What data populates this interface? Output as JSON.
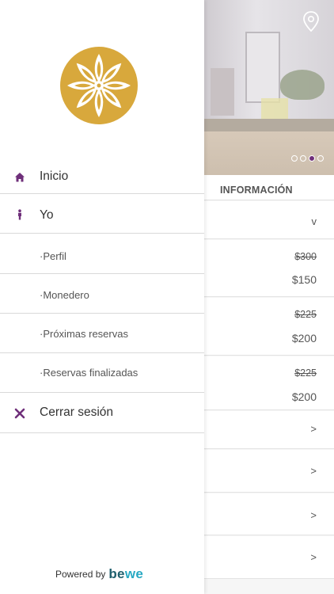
{
  "drawer": {
    "menu": [
      {
        "label": "Inicio",
        "icon": "home-icon"
      },
      {
        "label": "Yo",
        "icon": "person-icon"
      },
      {
        "label": "·Perfil"
      },
      {
        "label": "·Monedero"
      },
      {
        "label": "·Próximas reservas"
      },
      {
        "label": "·Reservas finalizadas"
      },
      {
        "label": "Cerrar sesión",
        "icon": "close-icon"
      }
    ],
    "footer": {
      "powered_by": "Powered by",
      "brand_be": "be",
      "brand_we": "we"
    }
  },
  "background": {
    "section_title": "INFORMACIÓN",
    "carousel": {
      "pages": 4,
      "active_index": 2
    },
    "rows": [
      {
        "chevron": "v"
      },
      {
        "old_price": "$300",
        "price": "$150"
      },
      {
        "old_price": "$225",
        "price": "$200"
      },
      {
        "old_price": "$225",
        "price": "$200"
      },
      {
        "chevron": ">"
      },
      {
        "chevron": ">"
      },
      {
        "chevron": ">"
      },
      {
        "chevron": ">"
      }
    ]
  },
  "colors": {
    "accent": "#6f2f7a",
    "logo_gold": "#d8a83c",
    "brand_dark": "#1f5f6d",
    "brand_light": "#29a9c3"
  }
}
